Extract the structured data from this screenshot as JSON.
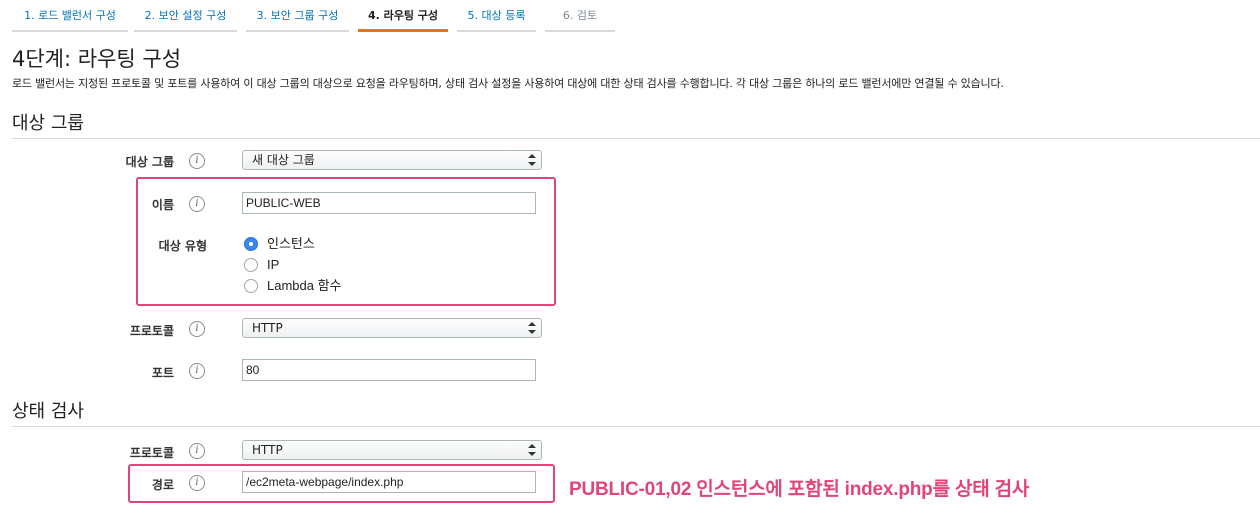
{
  "wizard": {
    "tabs": [
      {
        "label": "1. 로드 밸런서 구성",
        "state": "link"
      },
      {
        "label": "2. 보안 설정 구성",
        "state": "link"
      },
      {
        "label": "3. 보안 그룹 구성",
        "state": "link"
      },
      {
        "label": "4. 라우팅 구성",
        "state": "active"
      },
      {
        "label": "5. 대상 등록",
        "state": "link"
      },
      {
        "label": "6. 검토",
        "state": "disabled"
      }
    ]
  },
  "page": {
    "title": "4단계: 라우팅 구성",
    "description": "로드 밸런서는 지정된 프로토콜 및 포트를 사용하여 이 대상 그룹의 대상으로 요청을 라우팅하며, 상태 검사 설정을 사용하여 대상에 대한 상태 검사를 수행합니다. 각 대상 그룹은 하나의 로드 밸런서에만 연결될 수 있습니다."
  },
  "target_group": {
    "section_title": "대상 그룹",
    "target_group_label": "대상 그룹",
    "target_group_value": "새 대상 그룹",
    "name_label": "이름",
    "name_value": "PUBLIC-WEB",
    "target_type_label": "대상 유형",
    "target_type_options": [
      {
        "label": "인스턴스",
        "checked": true
      },
      {
        "label": "IP",
        "checked": false
      },
      {
        "label": "Lambda 함수",
        "checked": false
      }
    ],
    "protocol_label": "프로토콜",
    "protocol_value": "HTTP",
    "port_label": "포트",
    "port_value": "80"
  },
  "health_check": {
    "section_title": "상태 검사",
    "protocol_label": "프로토콜",
    "protocol_value": "HTTP",
    "path_label": "경로",
    "path_value": "/ec2meta-webpage/index.php"
  },
  "annotation": {
    "text": "PUBLIC-01,02 인스턴스에 포함된 index.php를 상태 검사"
  },
  "icons": {
    "info": "info-icon",
    "select_arrows": "select-arrows-icon"
  },
  "colors": {
    "link": "#0073bb",
    "active_tab_underline": "#ec7211",
    "highlight": "#e0457a",
    "radio_checked": "#3b86e8"
  }
}
